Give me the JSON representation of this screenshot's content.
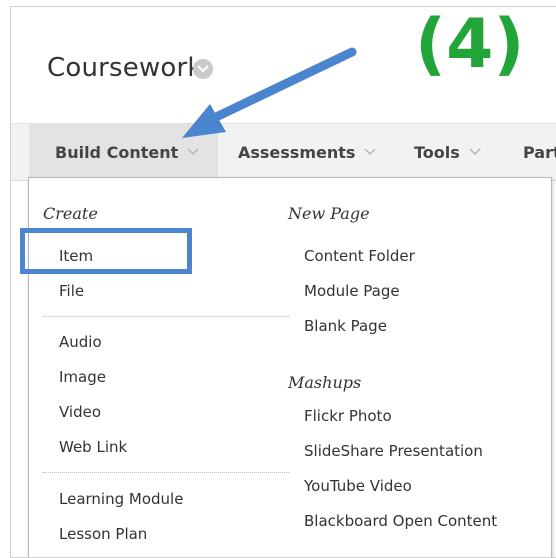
{
  "header": {
    "title": "Coursework",
    "step_label": "(4)"
  },
  "tabs": [
    {
      "label": "Build Content"
    },
    {
      "label": "Assessments"
    },
    {
      "label": "Tools"
    },
    {
      "label": "Part"
    }
  ],
  "menu": {
    "left": {
      "heading": "Create",
      "group1": [
        "Item",
        "File"
      ],
      "group2": [
        "Audio",
        "Image",
        "Video",
        "Web Link"
      ],
      "group3": [
        "Learning Module",
        "Lesson Plan"
      ]
    },
    "right": {
      "heading1": "New Page",
      "group1": [
        "Content Folder",
        "Module Page",
        "Blank Page"
      ],
      "heading2": "Mashups",
      "group2": [
        "Flickr Photo",
        "SlideShare Presentation",
        "YouTube Video",
        "Blackboard Open Content"
      ]
    }
  },
  "colors": {
    "accent_arrow": "#4b84cf",
    "step_green": "#22a538"
  },
  "icons": [
    "title-chevron-icon",
    "tab-chevron-icon",
    "pointer-arrow-icon"
  ]
}
